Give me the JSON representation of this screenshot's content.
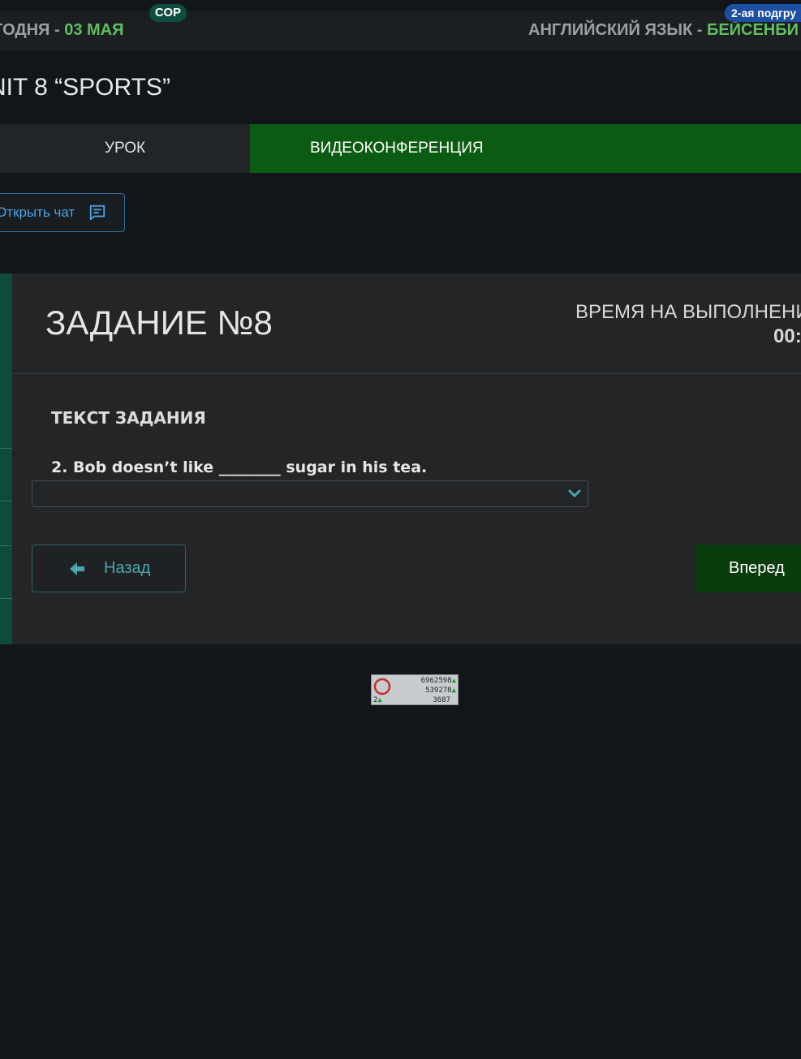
{
  "header": {
    "today_prefix": "ГОДНЯ - ",
    "today_date": "03 МАЯ",
    "sor_badge": "СОР",
    "subgroup_badge": "2-ая подгру",
    "subject_prefix": "АНГЛИЙСКИЙ ЯЗЫК - ",
    "teacher": "БЕЙСЕНБИ"
  },
  "lesson": {
    "unit_title": "NIT 8 “SPORTS”"
  },
  "tabs": [
    {
      "label": "УРОК"
    },
    {
      "label": "ВИДЕОКОНФЕРЕНЦИЯ"
    }
  ],
  "chat": {
    "label": "Открыть чат"
  },
  "task": {
    "title": "ЗАДАНИЕ №8",
    "time_label": "ВРЕМЯ НА ВЫПОЛНЕНИ",
    "time_value": "00:",
    "section_label": "ТЕКСТ ЗАДАНИЯ",
    "question": "2. Bob doesn’t like ________ sugar in his tea.",
    "answer_selected": ""
  },
  "nav": {
    "back_label": "Назад",
    "next_label": "Вперед"
  },
  "counter": {
    "line1": "6962598",
    "line2": "539278",
    "line3": "3687",
    "small": "2"
  },
  "colors": {
    "accent_green": "#5fbf5f",
    "tab_active": "#0b5c12",
    "next_button": "#093c0d",
    "sor_badge": "#0f4d40",
    "subgroup_badge": "#1d4fa3"
  }
}
